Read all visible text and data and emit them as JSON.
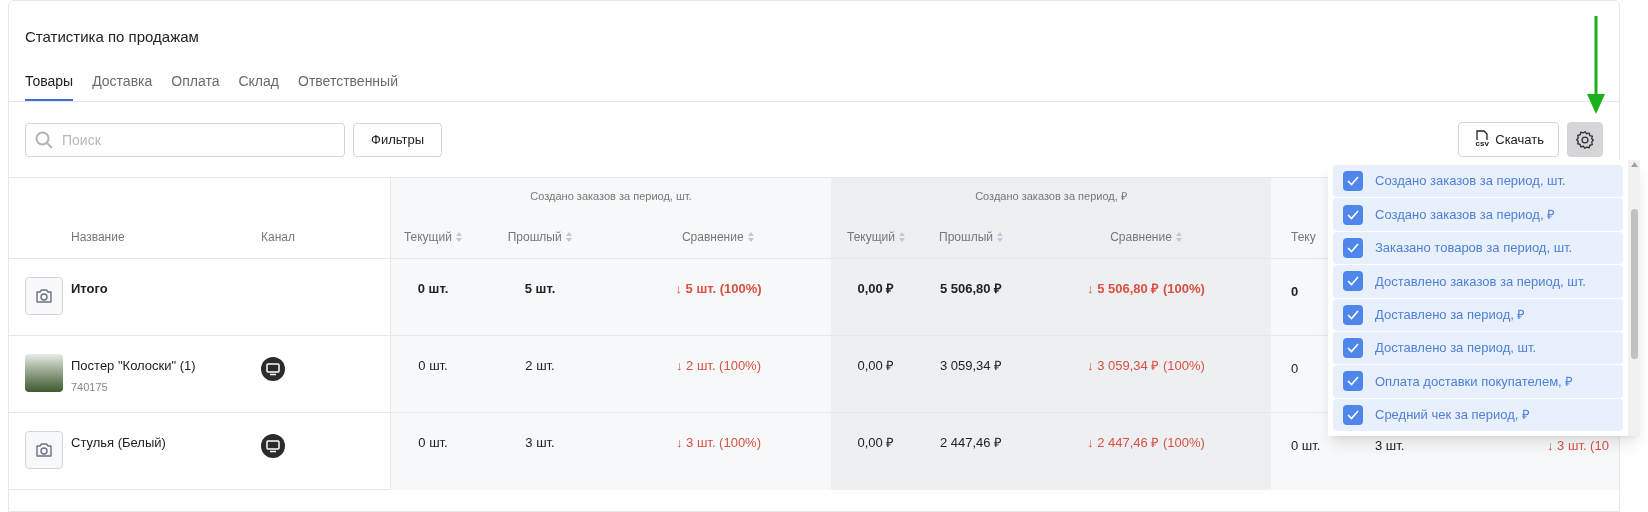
{
  "title": "Статистика по продажам",
  "tabs": [
    {
      "label": "Товары",
      "selected": true
    },
    {
      "label": "Доставка",
      "selected": false
    },
    {
      "label": "Оплата",
      "selected": false
    },
    {
      "label": "Склад",
      "selected": false
    },
    {
      "label": "Ответственный",
      "selected": false
    }
  ],
  "search": {
    "placeholder": "Поиск"
  },
  "filters_button": "Фильтры",
  "download_button": {
    "label": "Скачать",
    "file_type": "csv"
  },
  "table": {
    "name_header": "Название",
    "channel_header": "Канал",
    "groups": [
      {
        "title": "Создано заказов за период, шт.",
        "columns": [
          {
            "label": "Текущий",
            "sort_icon": true
          },
          {
            "label": "Прошлый",
            "sort_icon": true
          },
          {
            "label": "Сравнение",
            "sort_icon": true
          }
        ]
      },
      {
        "title": "Создано заказов за период, ₽",
        "columns": [
          {
            "label": "Текущий",
            "sort_icon": true
          },
          {
            "label": "Прошлый",
            "sort_icon": true
          },
          {
            "label": "Сравнение",
            "sort_icon": true
          }
        ]
      },
      {
        "columns": [
          {
            "label": "Теку",
            "sort_icon": false
          }
        ]
      }
    ],
    "rows": [
      {
        "kind": "total",
        "has_photo": false,
        "channel_icon": false,
        "name": "Итого",
        "values": [
          [
            "0 шт.",
            "5 шт.",
            "↓ 5 шт. (100%)"
          ],
          [
            "0,00 ₽",
            "5 506,80 ₽",
            "↓ 5 506,80 ₽ (100%)"
          ],
          [
            "0"
          ]
        ]
      },
      {
        "kind": "item",
        "has_photo": true,
        "name": "Постер \"Колоски\" (1)",
        "sku": "740175",
        "channel_icon": true,
        "values": [
          [
            "0 шт.",
            "2 шт.",
            "↓ 2 шт. (100%)"
          ],
          [
            "0,00 ₽",
            "3 059,34 ₽",
            "↓ 3 059,34 ₽ (100%)"
          ],
          [
            "0"
          ]
        ]
      },
      {
        "kind": "item",
        "has_photo": false,
        "name": "Стулья (Белый)",
        "channel_icon": true,
        "values": [
          [
            "0 шт.",
            "3 шт.",
            "↓ 3 шт. (100%)"
          ],
          [
            "0,00 ₽",
            "2 447,46 ₽",
            "↓ 2 447,46 ₽ (100%)"
          ],
          [
            "0 шт.",
            "3 шт.",
            "↓ 3 шт. (10"
          ]
        ]
      }
    ]
  },
  "column_picker": {
    "items": [
      {
        "label": "Создано заказов за период, шт.",
        "checked": true
      },
      {
        "label": "Создано заказов за период, ₽",
        "checked": true
      },
      {
        "label": "Заказано товаров за период, шт.",
        "checked": true
      },
      {
        "label": "Доставлено заказов за период, шт.",
        "checked": true
      },
      {
        "label": "Доставлено за период, ₽",
        "checked": true
      },
      {
        "label": "Доставлено за период, шт.",
        "checked": true
      },
      {
        "label": "Оплата доставки покупателем, ₽",
        "checked": true
      },
      {
        "label": "Средний чек за период, ₽",
        "checked": true
      }
    ]
  }
}
